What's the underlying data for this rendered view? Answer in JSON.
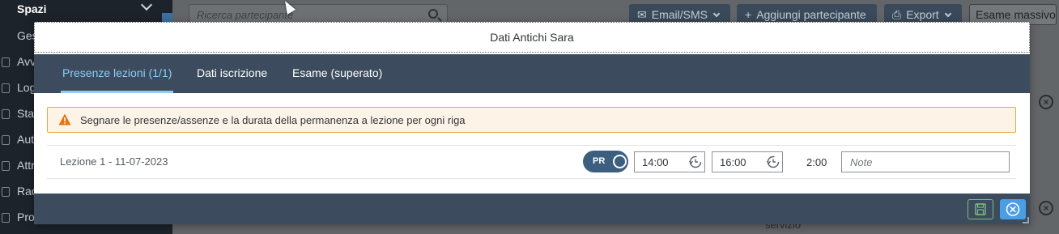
{
  "background": {
    "sidebar": {
      "top_item": "Spazi",
      "items": [
        "Ges",
        "Avv",
        "Log",
        "Sta",
        "Aut",
        "Attr",
        "Rac",
        "Pro"
      ]
    },
    "search_placeholder": "Ricerca partecipante",
    "buttons": {
      "email_sms": "Email/SMS",
      "add_participant": "Aggiungi partecipante",
      "export": "Export",
      "bulk_exam": "Esame massivo"
    },
    "service_text": "servizio"
  },
  "dialog": {
    "title": "Dati Antichi Sara",
    "tabs": [
      {
        "label": "Presenze lezioni (1/1)",
        "active": true
      },
      {
        "label": "Dati iscrizione",
        "active": false
      },
      {
        "label": "Esame (superato)",
        "active": false
      }
    ],
    "warning": "Segnare le presenze/assenze e la durata della permanenza a lezione per ogni riga",
    "lesson_row": {
      "label": "Lezione 1 - 11-07-2023",
      "presence_switch": "PR",
      "start_time": "14:00",
      "end_time": "16:00",
      "duration": "2:00",
      "note_placeholder": "Note"
    }
  },
  "colors": {
    "dialog_bar": "#3c4c5e",
    "active_tab": "#8ecbf7",
    "warning_bg": "#fdf3e6",
    "warning_border": "#eba74e",
    "switch_on": "#3c5f80",
    "close_button": "#4a9ee6",
    "save_border": "#7bbf7d"
  },
  "icons": {
    "warning": "warning-triangle-icon",
    "time": "clock-history-icon",
    "save": "floppy-disk-icon",
    "close": "close-circle-icon"
  }
}
